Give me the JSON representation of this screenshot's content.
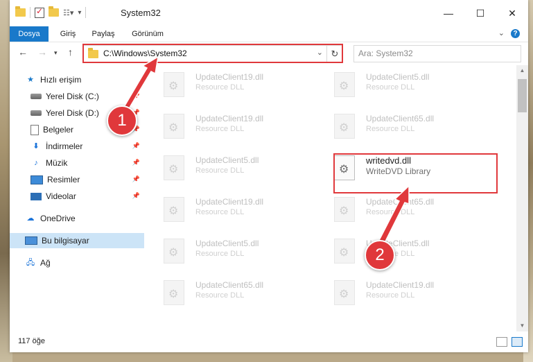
{
  "window": {
    "title": "System32",
    "minimize": "—",
    "maximize": "☐",
    "close": "✕"
  },
  "ribbon": {
    "tabs": [
      "Dosya",
      "Giriş",
      "Paylaş",
      "Görünüm"
    ],
    "help": "?"
  },
  "address": {
    "path": "C:\\Windows\\System32",
    "search_placeholder": "Ara: System32"
  },
  "nav_pane": {
    "items": [
      {
        "label": "Hızlı erişim",
        "icon": "star-icon"
      },
      {
        "label": "Yerel Disk (C:)",
        "icon": "disk-icon",
        "pinned": true
      },
      {
        "label": "Yerel Disk (D:)",
        "icon": "disk-icon",
        "pinned": true
      },
      {
        "label": "Belgeler",
        "icon": "document-icon",
        "pinned": true
      },
      {
        "label": "İndirmeler",
        "icon": "download-icon",
        "pinned": true
      },
      {
        "label": "Müzik",
        "icon": "music-icon",
        "pinned": true
      },
      {
        "label": "Resimler",
        "icon": "pictures-icon",
        "pinned": true
      },
      {
        "label": "Videolar",
        "icon": "video-icon",
        "pinned": true
      },
      {
        "label": "OneDrive",
        "icon": "cloud-icon"
      },
      {
        "label": "Bu bilgisayar",
        "icon": "computer-icon",
        "selected": true
      },
      {
        "label": "Ağ",
        "icon": "network-icon"
      }
    ]
  },
  "files": {
    "left": [
      {
        "name": "UpdateClient19.dll",
        "desc": "Resource DLL"
      },
      {
        "name": "UpdateClient19.dll",
        "desc": "Resource DLL"
      },
      {
        "name": "UpdateClient5.dll",
        "desc": "Resource DLL"
      },
      {
        "name": "UpdateClient19.dll",
        "desc": "Resource DLL"
      },
      {
        "name": "UpdateClient5.dll",
        "desc": "Resource DLL"
      },
      {
        "name": "UpdateClient65.dll",
        "desc": "Resource DLL"
      }
    ],
    "right": [
      {
        "name": "UpdateClient5.dll",
        "desc": "Resource DLL"
      },
      {
        "name": "UpdateClient65.dll",
        "desc": "Resource DLL"
      },
      {
        "name": "writedvd.dll",
        "desc": "WriteDVD Library",
        "highlighted": true
      },
      {
        "name": "UpdateClient65.dll",
        "desc": "Resource DLL"
      },
      {
        "name": "UpdateClient5.dll",
        "desc": "Resource DLL"
      },
      {
        "name": "UpdateClient19.dll",
        "desc": "Resource DLL"
      }
    ]
  },
  "status": {
    "count": "117 öğe"
  },
  "callouts": {
    "step1": "1",
    "step2": "2"
  },
  "colors": {
    "accent": "#1979ca",
    "callout_red": "#e0383b",
    "selection": "#cce4f7"
  }
}
